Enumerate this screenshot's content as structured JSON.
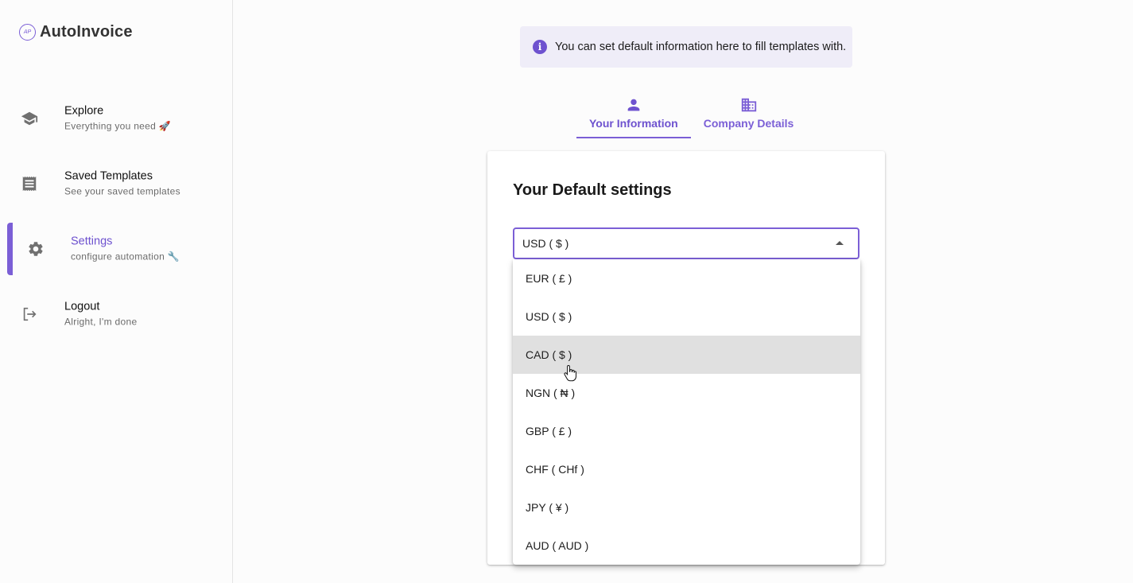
{
  "app": {
    "name": "AutoInvoice",
    "logo_mark": "AP"
  },
  "sidebar": {
    "items": [
      {
        "title": "Explore",
        "subtitle": "Everything you need 🚀",
        "icon": "school-icon"
      },
      {
        "title": "Saved Templates",
        "subtitle": "See your saved templates",
        "icon": "receipt-icon"
      },
      {
        "title": "Settings",
        "subtitle": "configure automation 🔧",
        "icon": "gear-icon",
        "active": true
      },
      {
        "title": "Logout",
        "subtitle": "Alright, I'm done",
        "icon": "logout-icon"
      }
    ]
  },
  "banner": {
    "icon": "info-icon",
    "icon_glyph": "i",
    "text": "You can set default information here to fill templates with."
  },
  "tabs": [
    {
      "label": "Your Information",
      "icon": "person-icon",
      "selected": true
    },
    {
      "label": "Company Details",
      "icon": "building-icon",
      "selected": false
    }
  ],
  "card": {
    "title": "Your Default settings"
  },
  "currency_select": {
    "value": "USD ( $ )",
    "options": [
      "EUR ( £ )",
      "USD ( $ )",
      "CAD ( $ )",
      "NGN ( ₦ )",
      "GBP ( £ )",
      "CHF ( CHf )",
      "JPY ( ¥ )",
      "AUD ( AUD )"
    ],
    "hovered_option": "CAD ( $ )"
  },
  "colors": {
    "accent": "#7b5fd6",
    "hover": "#e0e0e0",
    "banner_bg": "#efedf8"
  }
}
